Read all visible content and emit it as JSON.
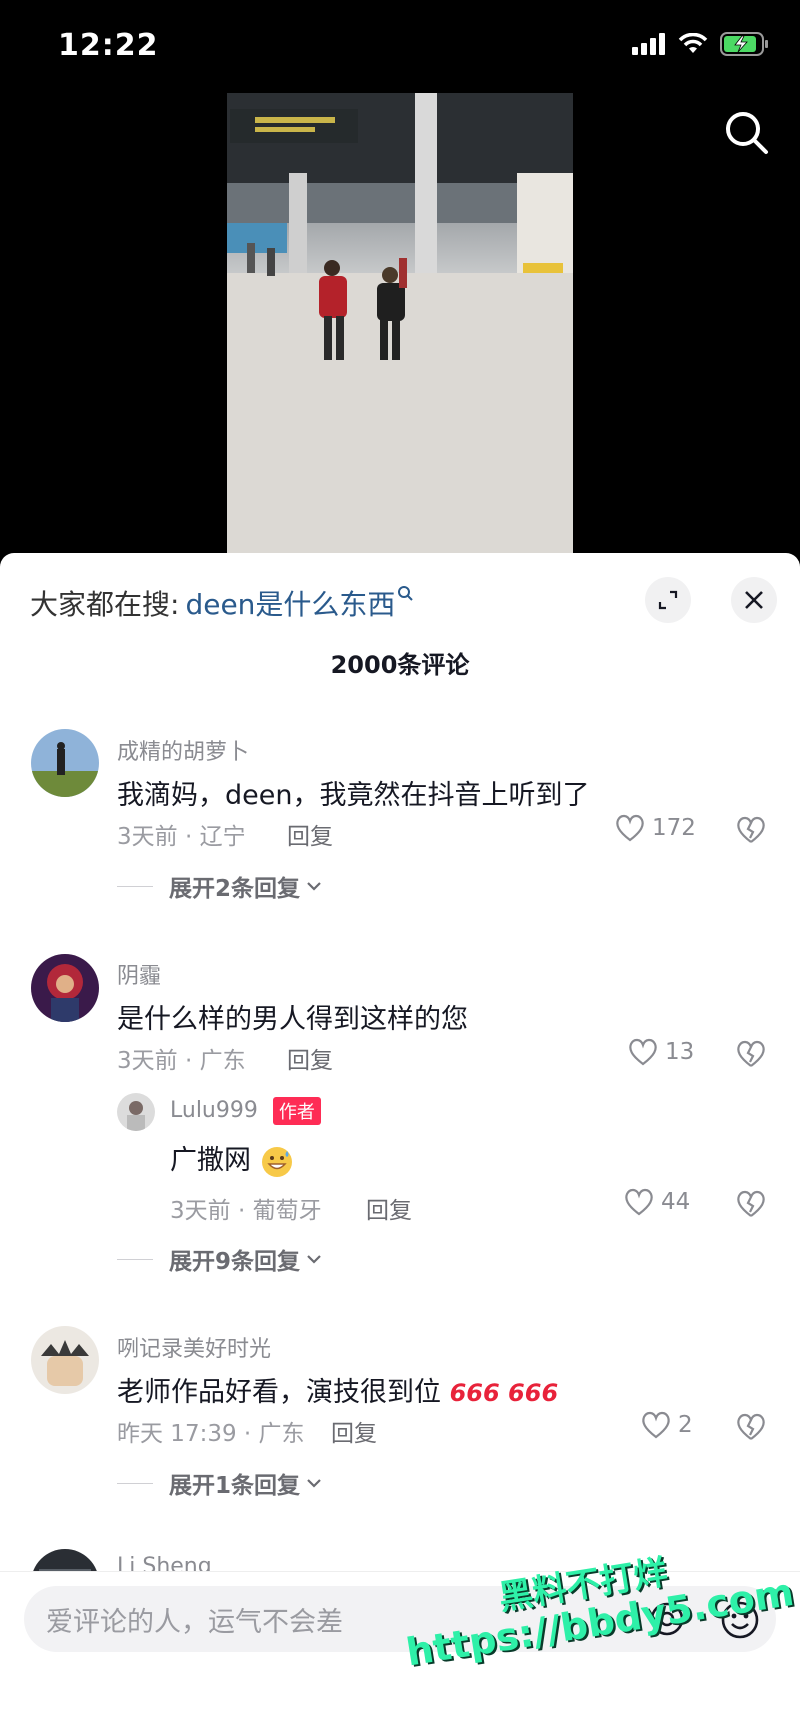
{
  "status_bar": {
    "time": "12:22"
  },
  "hot_search": {
    "prefix": "大家都在搜:",
    "keyword": "deen是什么东西"
  },
  "comment_count": "2000条评论",
  "comments": [
    {
      "user": "成精的胡萝卜",
      "text": "我滴妈，deen，我竟然在抖音上听到了",
      "meta": "3天前 · 辽宁",
      "reply_label": "回复",
      "likes": "172",
      "expand": "展开2条回复"
    },
    {
      "user": "阴霾",
      "text": "是什么样的男人得到这样的您",
      "meta": "3天前 · 广东",
      "reply_label": "回复",
      "likes": "13",
      "sub_reply": {
        "user": "Lulu999",
        "badge": "作者",
        "text": "广撒网",
        "meta": "3天前 · 葡萄牙",
        "reply_label": "回复",
        "likes": "44"
      },
      "expand": "展开9条回复"
    },
    {
      "user": "咧记录美好时光",
      "text": "老师作品好看，演技很到位",
      "emoji_text": "666 666",
      "meta": "昨天 17:39 · 广东",
      "reply_label": "回复",
      "likes": "2",
      "expand": "展开1条回复"
    },
    {
      "user": "Li Sheng"
    }
  ],
  "input": {
    "placeholder": "爱评论的人，运气不会差"
  },
  "watermark": {
    "line1": "黑料不打烊",
    "line2": "https://bbdy5.com"
  },
  "icons": {
    "search": "search-icon",
    "expand": "expand-icon",
    "close": "close-icon",
    "heart": "heart-icon",
    "dislike": "dislike-icon",
    "at": "at-icon",
    "emoji": "emoji-icon"
  },
  "colors": {
    "accent": "#fe2c55",
    "link": "#2a5a8c",
    "watermark": "#2ef0a8"
  }
}
